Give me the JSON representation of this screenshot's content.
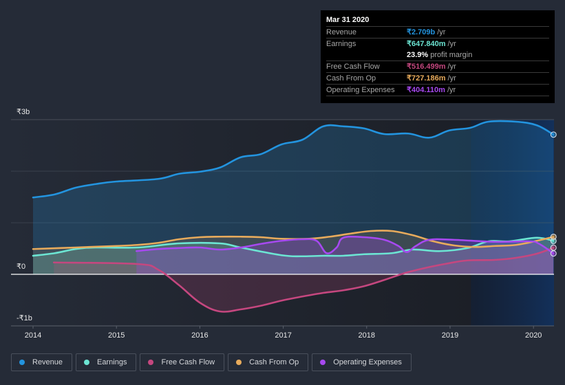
{
  "tooltip": {
    "date": "Mar 31 2020",
    "rows": [
      {
        "label": "Revenue",
        "value": "₹2.709b",
        "unit": "/yr",
        "color": "#2394df"
      },
      {
        "label": "Earnings",
        "value": "₹647.840m",
        "unit": "/yr",
        "color": "#6ce5d3"
      },
      {
        "label": "",
        "value": "23.9%",
        "unit": "profit margin",
        "color": "#ffffff"
      },
      {
        "label": "Free Cash Flow",
        "value": "₹516.499m",
        "unit": "/yr",
        "color": "#c5477f"
      },
      {
        "label": "Cash From Op",
        "value": "₹727.186m",
        "unit": "/yr",
        "color": "#e8ab5c"
      },
      {
        "label": "Operating Expenses",
        "value": "₹404.110m",
        "unit": "/yr",
        "color": "#a749f0"
      }
    ]
  },
  "legend": [
    {
      "label": "Revenue",
      "color": "#2394df"
    },
    {
      "label": "Earnings",
      "color": "#6ce5d3"
    },
    {
      "label": "Free Cash Flow",
      "color": "#c5477f"
    },
    {
      "label": "Cash From Op",
      "color": "#e8ab5c"
    },
    {
      "label": "Operating Expenses",
      "color": "#a749f0"
    }
  ],
  "chart_data": {
    "type": "area",
    "title": "",
    "xlabel": "",
    "ylabel": "",
    "currency": "₹",
    "ylim": [
      -1.0,
      3.0
    ],
    "y_unit": "billions",
    "ytick_labels": [
      {
        "value": 3,
        "label": "₹3b"
      },
      {
        "value": 0,
        "label": "₹0"
      },
      {
        "value": -1,
        "label": "-₹1b"
      }
    ],
    "gridlines_at": [
      3,
      2,
      1
    ],
    "xlim": [
      2013.74,
      2020.24
    ],
    "xticks": [
      2014,
      2015,
      2016,
      2017,
      2018,
      2019,
      2020
    ],
    "highlight_range": [
      2019.25,
      2020.24
    ],
    "grid": true,
    "legend_position": "bottom",
    "series": [
      {
        "name": "Revenue",
        "color": "#2394df",
        "x": [
          2014.0,
          2014.26,
          2014.51,
          2014.75,
          2015.0,
          2015.5,
          2015.75,
          2016.0,
          2016.24,
          2016.49,
          2016.73,
          2016.98,
          2017.23,
          2017.48,
          2017.72,
          2017.97,
          2018.21,
          2018.5,
          2018.75,
          2018.99,
          2019.24,
          2019.46,
          2019.79,
          2020.04,
          2020.24
        ],
        "values": [
          1.49,
          1.55,
          1.68,
          1.75,
          1.8,
          1.85,
          1.95,
          1.99,
          2.07,
          2.27,
          2.33,
          2.52,
          2.61,
          2.87,
          2.87,
          2.83,
          2.72,
          2.73,
          2.65,
          2.79,
          2.84,
          2.96,
          2.96,
          2.89,
          2.709
        ]
      },
      {
        "name": "Earnings",
        "color": "#6ce5d3",
        "x": [
          2014.0,
          2014.26,
          2014.51,
          2014.75,
          2015.25,
          2015.75,
          2016.24,
          2016.49,
          2016.98,
          2017.23,
          2017.48,
          2017.72,
          2017.97,
          2018.3,
          2018.55,
          2018.88,
          2019.21,
          2019.46,
          2019.71,
          2020.04,
          2020.24
        ],
        "values": [
          0.36,
          0.41,
          0.49,
          0.52,
          0.52,
          0.6,
          0.6,
          0.52,
          0.37,
          0.35,
          0.36,
          0.36,
          0.39,
          0.41,
          0.48,
          0.45,
          0.51,
          0.64,
          0.64,
          0.71,
          0.648
        ]
      },
      {
        "name": "Free Cash Flow",
        "color": "#c5477f",
        "x": [
          2014.25,
          2015.25,
          2015.5,
          2015.75,
          2016.0,
          2016.24,
          2016.49,
          2016.73,
          2016.98,
          2017.23,
          2017.48,
          2017.72,
          2017.97,
          2018.21,
          2018.47,
          2018.72,
          2018.97,
          2019.21,
          2019.54,
          2019.79,
          2020.04,
          2020.24
        ],
        "values": [
          0.23,
          0.2,
          0.09,
          -0.21,
          -0.55,
          -0.72,
          -0.68,
          -0.61,
          -0.51,
          -0.43,
          -0.36,
          -0.31,
          -0.23,
          -0.11,
          0.03,
          0.13,
          0.21,
          0.27,
          0.28,
          0.32,
          0.4,
          0.516
        ]
      },
      {
        "name": "Cash From Op",
        "color": "#e8ab5c",
        "x": [
          2014.0,
          2014.51,
          2015.0,
          2015.25,
          2015.5,
          2015.75,
          2016.0,
          2016.24,
          2016.49,
          2016.73,
          2016.98,
          2017.31,
          2017.56,
          2017.81,
          2018.05,
          2018.3,
          2018.55,
          2018.8,
          2019.05,
          2019.29,
          2019.54,
          2019.79,
          2020.04,
          2020.24
        ],
        "values": [
          0.49,
          0.52,
          0.55,
          0.57,
          0.61,
          0.68,
          0.72,
          0.73,
          0.73,
          0.72,
          0.69,
          0.69,
          0.73,
          0.79,
          0.84,
          0.84,
          0.76,
          0.64,
          0.56,
          0.53,
          0.55,
          0.57,
          0.65,
          0.727
        ]
      },
      {
        "name": "Operating Expenses",
        "color": "#a749f0",
        "x": [
          2015.24,
          2015.5,
          2015.75,
          2016.0,
          2016.24,
          2016.49,
          2016.73,
          2016.98,
          2017.23,
          2017.4,
          2017.52,
          2017.64,
          2017.72,
          2017.97,
          2018.21,
          2018.38,
          2018.48,
          2018.59,
          2018.75,
          2019.04,
          2019.54,
          2019.95,
          2020.07,
          2020.24
        ],
        "values": [
          0.45,
          0.49,
          0.51,
          0.52,
          0.48,
          0.52,
          0.59,
          0.65,
          0.68,
          0.65,
          0.41,
          0.52,
          0.71,
          0.72,
          0.67,
          0.55,
          0.43,
          0.55,
          0.67,
          0.67,
          0.63,
          0.64,
          0.59,
          0.404
        ]
      }
    ]
  }
}
